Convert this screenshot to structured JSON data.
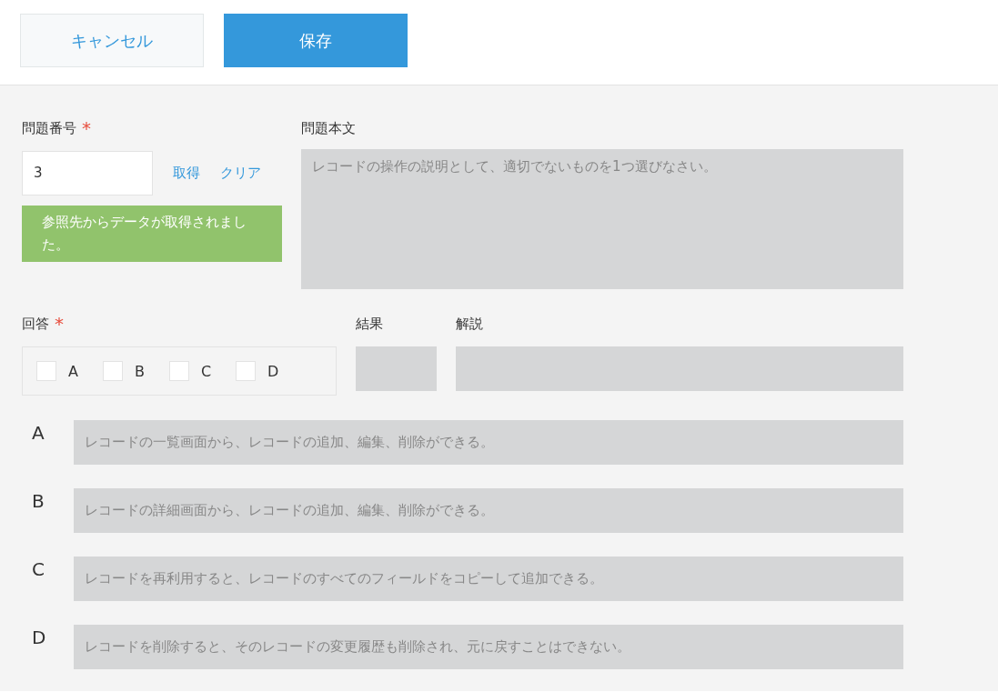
{
  "toolbar": {
    "cancel": "キャンセル",
    "save": "保存"
  },
  "question_number": {
    "label": "問題番号",
    "required_mark": "*",
    "value": "3",
    "fetch_link": "取得",
    "clear_link": "クリア",
    "message": "参照先からデータが取得されました。"
  },
  "question_text": {
    "label": "問題本文",
    "value": "レコードの操作の説明として、適切でないものを1つ選びなさい。"
  },
  "answer": {
    "label": "回答",
    "required_mark": "*",
    "options": [
      {
        "label": "A",
        "checked": false
      },
      {
        "label": "B",
        "checked": false
      },
      {
        "label": "C",
        "checked": false
      },
      {
        "label": "D",
        "checked": false
      }
    ]
  },
  "result": {
    "label": "結果"
  },
  "explanation": {
    "label": "解説"
  },
  "choices": [
    {
      "letter": "A",
      "text": "レコードの一覧画面から、レコードの追加、編集、削除ができる。"
    },
    {
      "letter": "B",
      "text": "レコードの詳細画面から、レコードの追加、編集、削除ができる。"
    },
    {
      "letter": "C",
      "text": "レコードを再利用すると、レコードのすべてのフィールドをコピーして追加できる。"
    },
    {
      "letter": "D",
      "text": "レコードを削除すると、そのレコードの変更履歴も削除され、元に戻すことはできない。"
    }
  ]
}
